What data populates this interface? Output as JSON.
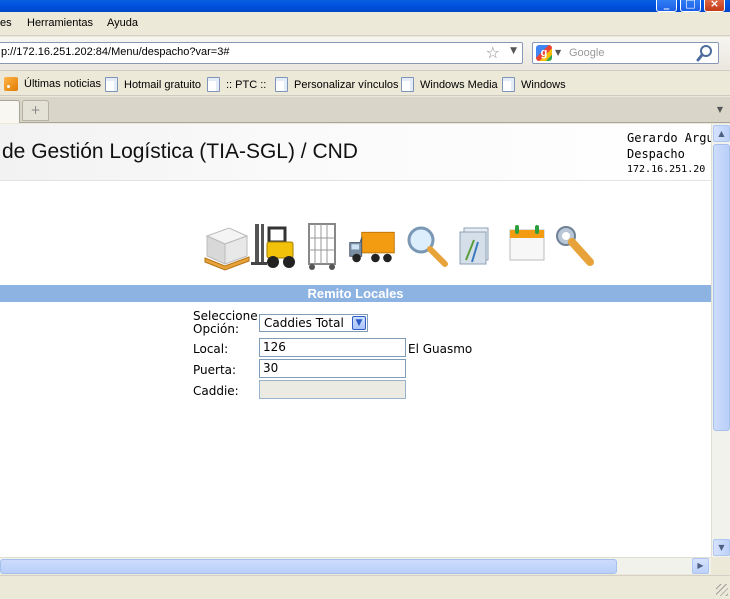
{
  "menubar": {
    "items": [
      "es",
      "Herramientas",
      "Ayuda"
    ]
  },
  "navbar": {
    "url": "p://172.16.251.202:84/Menu/despacho?var=3#",
    "search_placeholder": "Google"
  },
  "bookmarks": [
    "Últimas noticias",
    "Hotmail gratuito",
    ":: PTC ::",
    "Personalizar vínculos",
    "Windows Media",
    "Windows"
  ],
  "tabs": {
    "new_tab_symbol": "+"
  },
  "header": {
    "title": "de Gestión Logística (TIA-SGL) / CND",
    "user_name": "Gerardo Argu",
    "user_role": "Despacho",
    "user_ip": "172.16.251.20"
  },
  "modules": [
    "pallet-icon",
    "forklift-icon",
    "cage-cart-icon",
    "truck-icon",
    "search-icon",
    "folders-icon",
    "calendar-icon",
    "wrench-icon"
  ],
  "section": {
    "title": "Remito Locales"
  },
  "form": {
    "option_label": "Seleccione Opción:",
    "option_value": "Caddies Total",
    "local_label": "Local:",
    "local_value": "126",
    "store_name": "El Guasmo",
    "door_label": "Puerta:",
    "door_value": "30",
    "caddie_label": "Caddie:",
    "caddie_value": ""
  },
  "colors": {
    "section_bar": "#8DB3E2",
    "titlebar": "#0053E1"
  }
}
